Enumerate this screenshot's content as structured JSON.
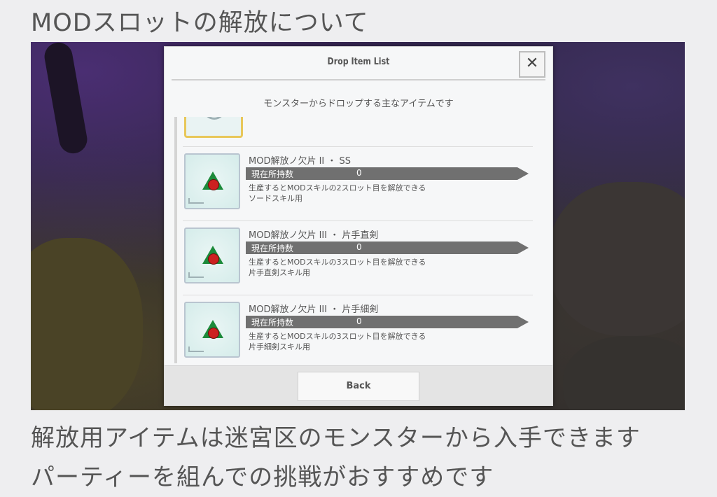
{
  "article": {
    "heading": "MODスロットの解放について",
    "caption_line1": "解放用アイテムは迷宮区のモンスターから入手できます",
    "caption_line2": "パーティーを組んでの挑戦がおすすめです"
  },
  "dialog": {
    "title": "Drop Item List",
    "close_glyph": "✕",
    "subtitle": "モンスターからドロップする主なアイテムです",
    "items": [
      {
        "name": "MOD解放ノ欠片 II ・ SS",
        "count_label": "現在所持数",
        "count": "0",
        "desc_line1": "生産するとMODスキルの2スロット目を解放できる",
        "desc_line2": "ソードスキル用"
      },
      {
        "name": "MOD解放ノ欠片 III ・ 片手直剣",
        "count_label": "現在所持数",
        "count": "0",
        "desc_line1": "生産するとMODスキルの3スロット目を解放できる",
        "desc_line2": "片手直剣スキル用"
      },
      {
        "name": "MOD解放ノ欠片 III ・ 片手細剣",
        "count_label": "現在所持数",
        "count": "0",
        "desc_line1": "生産するとMODスキルの3スロット目を解放できる",
        "desc_line2": "片手細剣スキル用"
      }
    ],
    "back_label": "Back"
  }
}
